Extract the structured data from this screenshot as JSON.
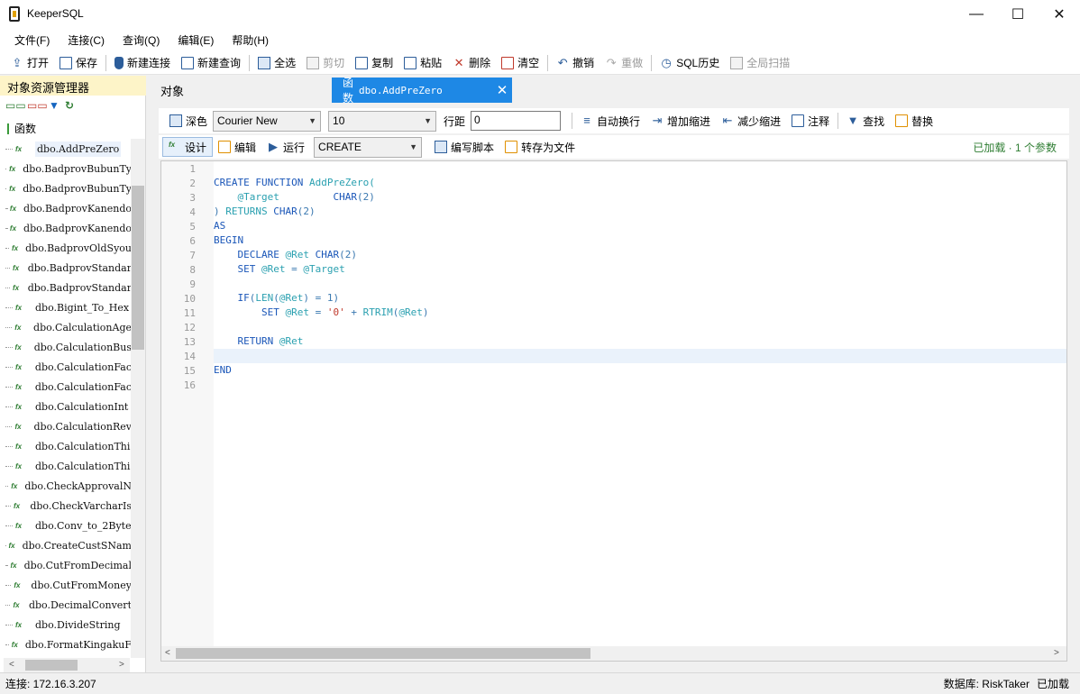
{
  "window": {
    "title": "KeeperSQL",
    "minimize": "—",
    "maximize": "☐",
    "close": "✕"
  },
  "menu": [
    "文件(F)",
    "连接(C)",
    "查询(Q)",
    "编辑(E)",
    "帮助(H)"
  ],
  "toolbar": {
    "open": "打开",
    "save": "保存",
    "new_connection": "新建连接",
    "new_query": "新建查询",
    "select_all": "全选",
    "cut": "剪切",
    "copy": "复制",
    "paste": "粘贴",
    "delete": "删除",
    "clear": "清空",
    "undo": "撤销",
    "redo": "重做",
    "sql_history": "SQL历史",
    "global_scan": "全局扫描"
  },
  "object_explorer": {
    "title": "对象资源管理器",
    "root": "函数",
    "items": [
      "dbo.AddPreZero",
      "dbo.BadprovBubunTy",
      "dbo.BadprovBubunTy",
      "dbo.BadprovKanendo",
      "dbo.BadprovKanendo",
      "dbo.BadprovOldSyou",
      "dbo.BadprovStandar",
      "dbo.BadprovStandar",
      "dbo.Bigint_To_Hex",
      "dbo.CalculationAge",
      "dbo.CalculationBus",
      "dbo.CalculationFac",
      "dbo.CalculationFac",
      "dbo.CalculationInt",
      "dbo.CalculationRev",
      "dbo.CalculationThi",
      "dbo.CalculationThi",
      "dbo.CheckApprovalN",
      "dbo.CheckVarcharIs",
      "dbo.Conv_to_2Byte",
      "dbo.CreateCustSNam",
      "dbo.CutFromDecimal",
      "dbo.CutFromMoney",
      "dbo.DecimalConvert",
      "dbo.DivideString",
      "dbo.FormatKingakuF"
    ],
    "selected_index": 0
  },
  "tabs": {
    "objects": "对象",
    "active_label": "函数",
    "active_name": "dbo.AddPreZero",
    "close": "✕"
  },
  "editor_toolbar": {
    "dark": "深色",
    "font": "Courier New",
    "font_size": "10",
    "line_spacing_label": "行距",
    "line_spacing_value": "0",
    "word_wrap": "自动换行",
    "indent": "增加缩进",
    "outdent": "减少缩进",
    "comment": "注释",
    "find": "查找",
    "replace": "替换",
    "design": "设计",
    "edit": "编辑",
    "run": "运行",
    "mode": "CREATE",
    "write_script": "编写脚本",
    "save_to_file": "转存为文件",
    "status": "已加载 · 1 个参数"
  },
  "code": {
    "line_count": 16,
    "current_line": 14
  },
  "statusbar": {
    "connection": "连接: 172.16.3.207",
    "database": "数据库: RiskTaker",
    "state": "已加载"
  }
}
